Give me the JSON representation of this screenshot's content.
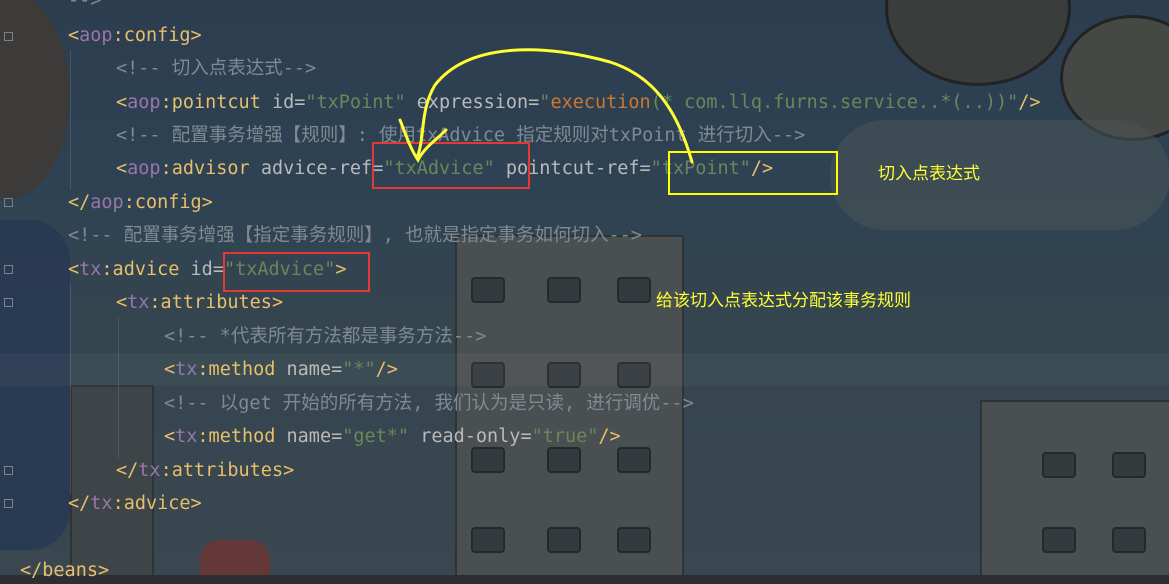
{
  "code_lines": [
    {
      "segments": [
        {
          "t": "-->",
          "c": "cmt"
        }
      ]
    },
    {
      "segments": [
        {
          "t": "<",
          "c": "tag"
        },
        {
          "t": "aop",
          "c": "ns"
        },
        {
          "t": ":config",
          "c": "tag"
        },
        {
          "t": ">",
          "c": "tag"
        }
      ]
    },
    {
      "segments": [
        {
          "t": "<!-- 切入点表达式-->",
          "c": "cmt"
        }
      ]
    },
    {
      "segments": [
        {
          "t": "<",
          "c": "tag"
        },
        {
          "t": "aop",
          "c": "ns"
        },
        {
          "t": ":pointcut ",
          "c": "tag"
        },
        {
          "t": "id",
          "c": "attr"
        },
        {
          "t": "=",
          "c": "pun"
        },
        {
          "t": "\"txPoint\" ",
          "c": "val"
        },
        {
          "t": "expression",
          "c": "attr"
        },
        {
          "t": "=",
          "c": "pun"
        },
        {
          "t": "\"",
          "c": "val"
        },
        {
          "t": "execution",
          "c": "kw"
        },
        {
          "t": "(* com.llq.furns.service..*(..))\"",
          "c": "val"
        },
        {
          "t": "/>",
          "c": "tag"
        }
      ]
    },
    {
      "segments": [
        {
          "t": "<!-- 配置事务增强【规则】: 使用txAdvice 指定规则对txPoint 进行切入-->",
          "c": "cmt"
        }
      ]
    },
    {
      "segments": [
        {
          "t": "<",
          "c": "tag"
        },
        {
          "t": "aop",
          "c": "ns"
        },
        {
          "t": ":advisor ",
          "c": "tag"
        },
        {
          "t": "advice-ref",
          "c": "attr"
        },
        {
          "t": "=",
          "c": "pun"
        },
        {
          "t": "\"txAdvice\" ",
          "c": "val"
        },
        {
          "t": "pointcut-ref",
          "c": "attr"
        },
        {
          "t": "=",
          "c": "pun"
        },
        {
          "t": "\"txPoint\"",
          "c": "val"
        },
        {
          "t": "/>",
          "c": "tag"
        }
      ]
    },
    {
      "segments": [
        {
          "t": "</",
          "c": "tag"
        },
        {
          "t": "aop",
          "c": "ns"
        },
        {
          "t": ":config",
          "c": "tag"
        },
        {
          "t": ">",
          "c": "tag"
        }
      ]
    },
    {
      "segments": [
        {
          "t": "<!-- 配置事务增强【指定事务规则】, 也就是指定事务如何切入-->",
          "c": "cmt"
        }
      ]
    },
    {
      "segments": [
        {
          "t": "<",
          "c": "tag"
        },
        {
          "t": "tx",
          "c": "ns"
        },
        {
          "t": ":advice ",
          "c": "tag"
        },
        {
          "t": "id",
          "c": "attr"
        },
        {
          "t": "=",
          "c": "pun"
        },
        {
          "t": "\"txAdvice\"",
          "c": "val"
        },
        {
          "t": ">",
          "c": "tag"
        }
      ]
    },
    {
      "segments": [
        {
          "t": "<",
          "c": "tag"
        },
        {
          "t": "tx",
          "c": "ns"
        },
        {
          "t": ":attributes",
          "c": "tag"
        },
        {
          "t": ">",
          "c": "tag"
        }
      ]
    },
    {
      "segments": [
        {
          "t": "<!-- *代表所有方法都是事务方法-->",
          "c": "cmt"
        }
      ]
    },
    {
      "segments": [
        {
          "t": "<",
          "c": "tag"
        },
        {
          "t": "tx",
          "c": "ns"
        },
        {
          "t": ":method ",
          "c": "tag"
        },
        {
          "t": "name",
          "c": "attr"
        },
        {
          "t": "=",
          "c": "pun"
        },
        {
          "t": "\"*\"",
          "c": "val"
        },
        {
          "t": "/>",
          "c": "tag"
        }
      ]
    },
    {
      "segments": [
        {
          "t": "<!-- 以get 开始的所有方法, 我们认为是只读, 进行调优-->",
          "c": "cmt"
        }
      ]
    },
    {
      "segments": [
        {
          "t": "<",
          "c": "tag"
        },
        {
          "t": "tx",
          "c": "ns"
        },
        {
          "t": ":method ",
          "c": "tag"
        },
        {
          "t": "name",
          "c": "attr"
        },
        {
          "t": "=",
          "c": "pun"
        },
        {
          "t": "\"get*\" ",
          "c": "val"
        },
        {
          "t": "read-only",
          "c": "attr"
        },
        {
          "t": "=",
          "c": "pun"
        },
        {
          "t": "\"true\"",
          "c": "val"
        },
        {
          "t": "/>",
          "c": "tag"
        }
      ]
    },
    {
      "segments": [
        {
          "t": "</",
          "c": "tag"
        },
        {
          "t": "tx",
          "c": "ns"
        },
        {
          "t": ":attributes",
          "c": "tag"
        },
        {
          "t": ">",
          "c": "tag"
        }
      ]
    },
    {
      "segments": [
        {
          "t": "</",
          "c": "tag"
        },
        {
          "t": "tx",
          "c": "ns"
        },
        {
          "t": ":advice",
          "c": "tag"
        },
        {
          "t": ">",
          "c": "tag"
        }
      ]
    },
    {
      "segments": []
    },
    {
      "segments": [
        {
          "t": "</",
          "c": "tag"
        },
        {
          "t": "beans",
          "c": "tag"
        },
        {
          "t": ">",
          "c": "tag"
        }
      ]
    }
  ],
  "annotations": {
    "pointcut_label": "切入点表达式",
    "assign_label": "给该切入点表达式分配该事务规则"
  },
  "colors": {
    "tag": "#e8bf6a",
    "namespace": "#9876aa",
    "attribute": "#bababa",
    "string_value": "#6a8759",
    "comment": "#7f8a92",
    "annotation_text": "#ffff33",
    "box_red": "#e53935",
    "box_yellow": "#ffff00"
  }
}
